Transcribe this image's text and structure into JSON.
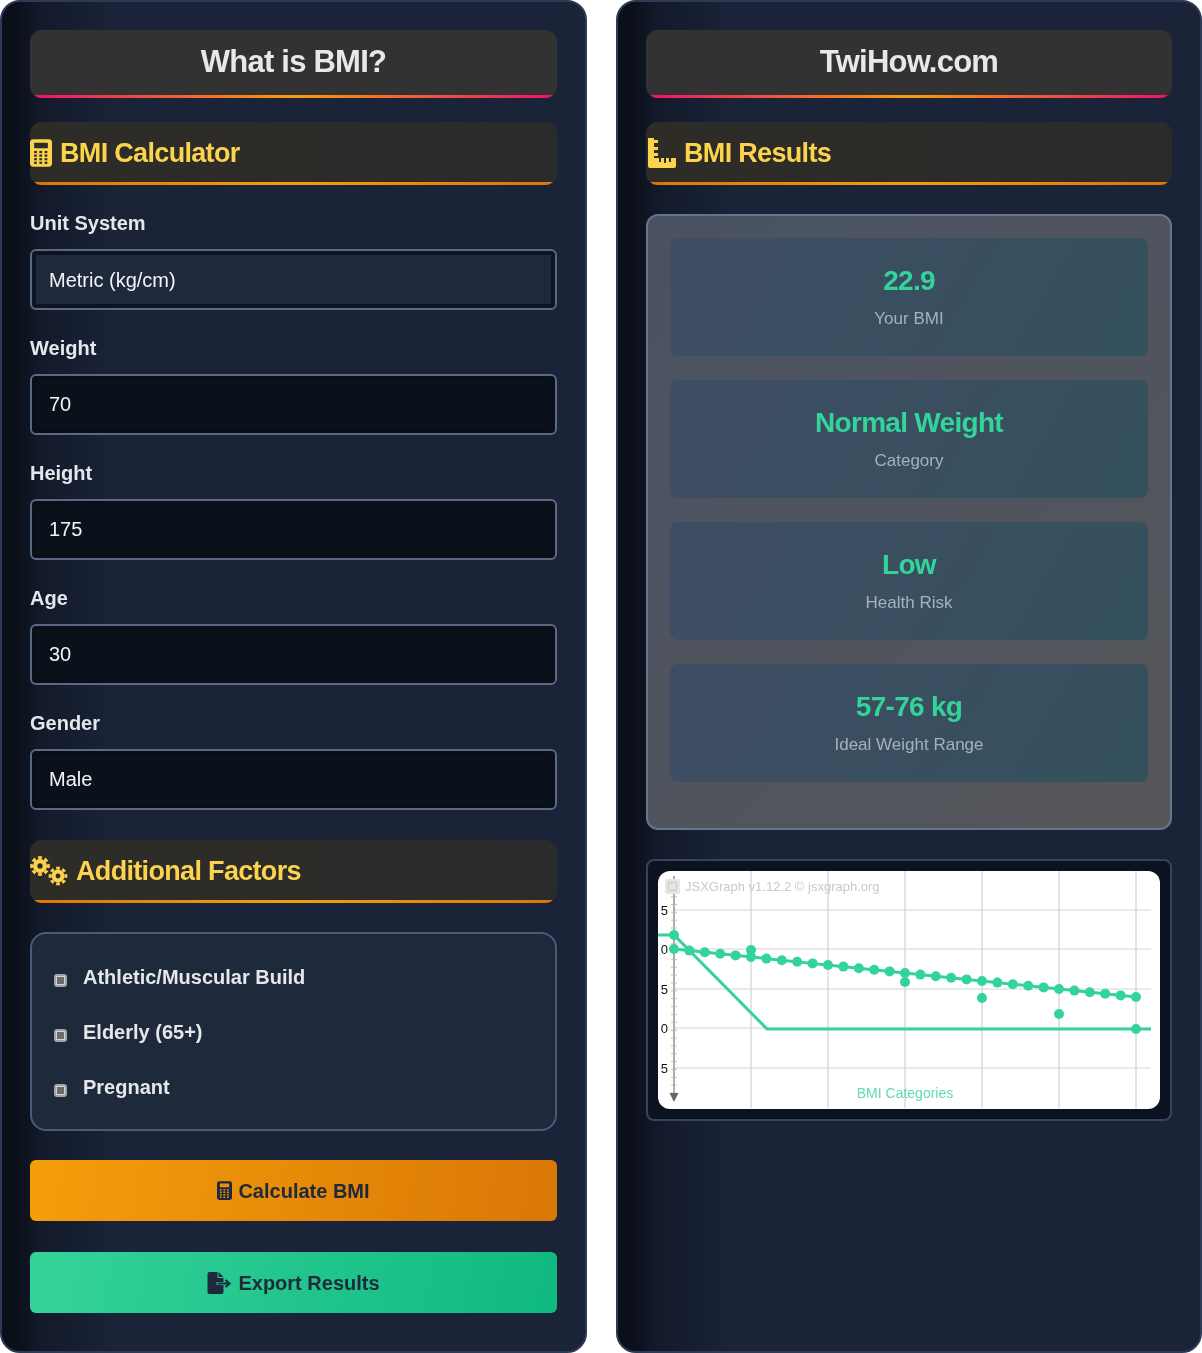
{
  "calculator_panel": {
    "title": "What is BMI?",
    "section_title": "BMI Calculator",
    "fields": [
      {
        "label": "Unit System",
        "kind": "select",
        "value": "Metric (kg/cm)"
      },
      {
        "label": "Weight",
        "kind": "input",
        "value": "70"
      },
      {
        "label": "Height",
        "kind": "input",
        "value": "175"
      },
      {
        "label": "Age",
        "kind": "input",
        "value": "30"
      },
      {
        "label": "Gender",
        "kind": "input",
        "value": "Male"
      }
    ],
    "factors_title": "Additional Factors",
    "factors": [
      {
        "label": "Athletic/Muscular Build",
        "checked": false
      },
      {
        "label": "Elderly (65+)",
        "checked": false
      },
      {
        "label": "Pregnant",
        "checked": false
      }
    ],
    "buttons": [
      {
        "kind": "calculate",
        "label": "Calculate BMI"
      },
      {
        "kind": "export",
        "label": "Export Results"
      }
    ]
  },
  "results_panel": {
    "title": "TwiHow.com",
    "section_title": "BMI Results",
    "results": [
      {
        "value": "22.9",
        "label": "Your BMI"
      },
      {
        "value": "Normal Weight",
        "label": "Category"
      },
      {
        "value": "Low",
        "label": "Health Risk"
      },
      {
        "value": "57-76 kg",
        "label": "Ideal Weight Range"
      }
    ],
    "chart": {
      "credit": "JSXGraph v1.12.2 © jsxgraph.org",
      "y_tick_labels": [
        "5",
        "0",
        "5",
        "0",
        "5"
      ],
      "caption": "BMI Categories"
    }
  }
}
